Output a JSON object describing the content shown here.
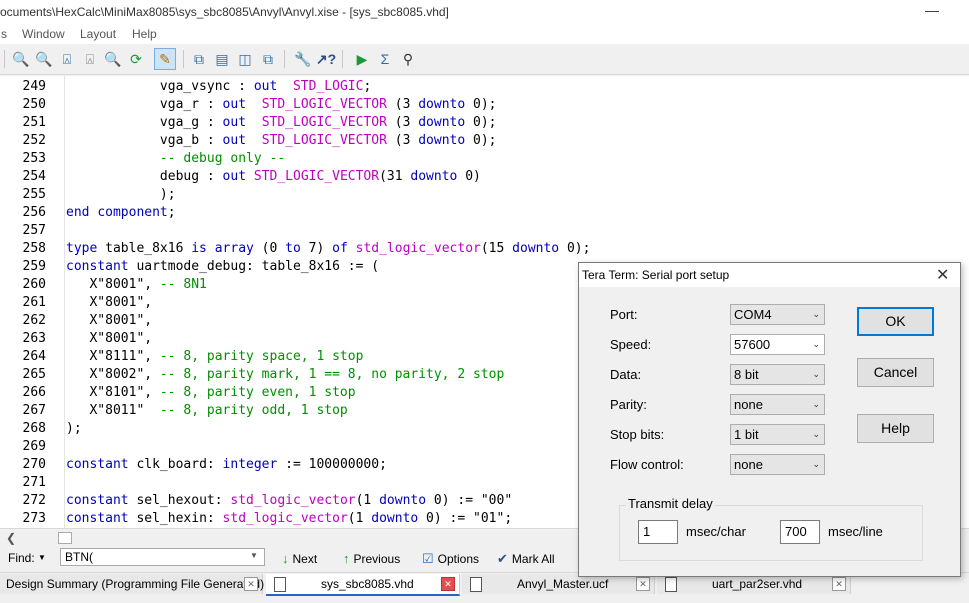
{
  "window": {
    "title": "ocuments\\HexCalc\\MiniMax8085\\sys_sbc8085\\Anvyl\\Anvyl.xise - [sys_sbc8085.vhd]",
    "minimize": "—"
  },
  "menu": [
    "s",
    "Window",
    "Layout",
    "Help"
  ],
  "toolbar_icons": [
    "zoom-in-icon",
    "zoom-out-icon",
    "zoom-fit-icon",
    "zoom-full-icon",
    "zoom-area-icon",
    "refresh-icon",
    "tree-icon",
    "cascade-icon",
    "tile-horizontal-icon",
    "tile-vertical-icon",
    "float-icon",
    "properties-icon",
    "help-context-icon",
    "run-icon",
    "sum-icon",
    "view-icon"
  ],
  "editor": {
    "lines": [
      {
        "n": "249",
        "segs": [
          {
            "t": "            vga_vsync : "
          },
          {
            "t": "out",
            "c": "kw"
          },
          {
            "t": "  "
          },
          {
            "t": "STD_LOGIC",
            "c": "ty"
          },
          {
            "t": ";"
          }
        ]
      },
      {
        "n": "250",
        "segs": [
          {
            "t": "            vga_r : "
          },
          {
            "t": "out",
            "c": "kw"
          },
          {
            "t": "  "
          },
          {
            "t": "STD_LOGIC_VECTOR",
            "c": "ty"
          },
          {
            "t": " (3 "
          },
          {
            "t": "downto",
            "c": "kw"
          },
          {
            "t": " 0);"
          }
        ]
      },
      {
        "n": "251",
        "segs": [
          {
            "t": "            vga_g : "
          },
          {
            "t": "out",
            "c": "kw"
          },
          {
            "t": "  "
          },
          {
            "t": "STD_LOGIC_VECTOR",
            "c": "ty"
          },
          {
            "t": " (3 "
          },
          {
            "t": "downto",
            "c": "kw"
          },
          {
            "t": " 0);"
          }
        ]
      },
      {
        "n": "252",
        "segs": [
          {
            "t": "            vga_b : "
          },
          {
            "t": "out",
            "c": "kw"
          },
          {
            "t": "  "
          },
          {
            "t": "STD_LOGIC_VECTOR",
            "c": "ty"
          },
          {
            "t": " (3 "
          },
          {
            "t": "downto",
            "c": "kw"
          },
          {
            "t": " 0);"
          }
        ]
      },
      {
        "n": "253",
        "segs": [
          {
            "t": "            "
          },
          {
            "t": "-- debug only --",
            "c": "cm"
          }
        ]
      },
      {
        "n": "254",
        "segs": [
          {
            "t": "            debug : "
          },
          {
            "t": "out",
            "c": "kw"
          },
          {
            "t": " "
          },
          {
            "t": "STD_LOGIC_VECTOR",
            "c": "ty"
          },
          {
            "t": "(31 "
          },
          {
            "t": "downto",
            "c": "kw"
          },
          {
            "t": " 0)"
          }
        ]
      },
      {
        "n": "255",
        "segs": [
          {
            "t": "            );"
          }
        ]
      },
      {
        "n": "256",
        "segs": [
          {
            "t": "end",
            "c": "kw"
          },
          {
            "t": " "
          },
          {
            "t": "component",
            "c": "kw"
          },
          {
            "t": ";"
          }
        ]
      },
      {
        "n": "257",
        "segs": [
          {
            "t": ""
          }
        ]
      },
      {
        "n": "258",
        "segs": [
          {
            "t": "type",
            "c": "kw"
          },
          {
            "t": " table_8x16 "
          },
          {
            "t": "is",
            "c": "kw"
          },
          {
            "t": " "
          },
          {
            "t": "array",
            "c": "kw"
          },
          {
            "t": " (0 "
          },
          {
            "t": "to",
            "c": "kw"
          },
          {
            "t": " 7) "
          },
          {
            "t": "of",
            "c": "kw"
          },
          {
            "t": " "
          },
          {
            "t": "std_logic_vector",
            "c": "ty"
          },
          {
            "t": "(15 "
          },
          {
            "t": "downto",
            "c": "kw"
          },
          {
            "t": " 0);"
          }
        ]
      },
      {
        "n": "259",
        "segs": [
          {
            "t": "constant",
            "c": "kw"
          },
          {
            "t": " uartmode_debug: table_8x16 := ("
          }
        ]
      },
      {
        "n": "260",
        "segs": [
          {
            "t": "   X\"8001\", "
          },
          {
            "t": "-- 8N1",
            "c": "cm"
          }
        ]
      },
      {
        "n": "261",
        "segs": [
          {
            "t": "   X\"8001\","
          }
        ]
      },
      {
        "n": "262",
        "segs": [
          {
            "t": "   X\"8001\","
          }
        ]
      },
      {
        "n": "263",
        "segs": [
          {
            "t": "   X\"8001\","
          }
        ]
      },
      {
        "n": "264",
        "segs": [
          {
            "t": "   X\"8111\", "
          },
          {
            "t": "-- 8, parity space, 1 stop",
            "c": "cm"
          }
        ]
      },
      {
        "n": "265",
        "segs": [
          {
            "t": "   X\"8002\", "
          },
          {
            "t": "-- 8, parity mark, 1 == 8, no parity, 2 stop",
            "c": "cm"
          }
        ]
      },
      {
        "n": "266",
        "segs": [
          {
            "t": "   X\"8101\", "
          },
          {
            "t": "-- 8, parity even, 1 stop",
            "c": "cm"
          }
        ]
      },
      {
        "n": "267",
        "segs": [
          {
            "t": "   X\"8011\"  "
          },
          {
            "t": "-- 8, parity odd, 1 stop",
            "c": "cm"
          }
        ]
      },
      {
        "n": "268",
        "segs": [
          {
            "t": ");"
          }
        ]
      },
      {
        "n": "269",
        "segs": [
          {
            "t": ""
          }
        ]
      },
      {
        "n": "270",
        "segs": [
          {
            "t": "constant",
            "c": "kw"
          },
          {
            "t": " clk_board: "
          },
          {
            "t": "integer",
            "c": "kw"
          },
          {
            "t": " := 100000000;"
          }
        ]
      },
      {
        "n": "271",
        "segs": [
          {
            "t": ""
          }
        ]
      },
      {
        "n": "272",
        "segs": [
          {
            "t": "constant",
            "c": "kw"
          },
          {
            "t": " sel_hexout: "
          },
          {
            "t": "std_logic_vector",
            "c": "ty"
          },
          {
            "t": "(1 "
          },
          {
            "t": "downto",
            "c": "kw"
          },
          {
            "t": " 0) := \"00\""
          }
        ]
      },
      {
        "n": "273",
        "segs": [
          {
            "t": "constant",
            "c": "kw"
          },
          {
            "t": " sel_hexin: "
          },
          {
            "t": "std_logic_vector",
            "c": "ty"
          },
          {
            "t": "(1 "
          },
          {
            "t": "downto",
            "c": "kw"
          },
          {
            "t": " 0) := \"01\";"
          }
        ]
      }
    ],
    "colors": {
      "kw": "#0000c0",
      "ty": "#c000c0",
      "cm": "#009000"
    }
  },
  "find": {
    "label": "Find:",
    "value": "BTN(",
    "next": "Next",
    "previous": "Previous",
    "options": "Options",
    "mark_all": "Mark All"
  },
  "tabs": [
    {
      "label": "Design Summary (Programming File Generated)",
      "active": false
    },
    {
      "label": "sys_sbc8085.vhd",
      "active": true
    },
    {
      "label": "Anvyl_Master.ucf",
      "active": false
    },
    {
      "label": "uart_par2ser.vhd",
      "active": false
    }
  ],
  "dialog": {
    "title": "Tera Term: Serial port setup",
    "fields": {
      "port": {
        "label": "Port:",
        "value": "COM4"
      },
      "speed": {
        "label": "Speed:",
        "value": "57600"
      },
      "data": {
        "label": "Data:",
        "value": "8 bit"
      },
      "parity": {
        "label": "Parity:",
        "value": "none"
      },
      "stop_bits": {
        "label": "Stop bits:",
        "value": "1 bit"
      },
      "flow_control": {
        "label": "Flow control:",
        "value": "none"
      }
    },
    "buttons": {
      "ok": "OK",
      "cancel": "Cancel",
      "help": "Help"
    },
    "transmit_delay": {
      "label": "Transmit delay",
      "char_value": "1",
      "char_unit": "msec/char",
      "line_value": "700",
      "line_unit": "msec/line"
    }
  }
}
